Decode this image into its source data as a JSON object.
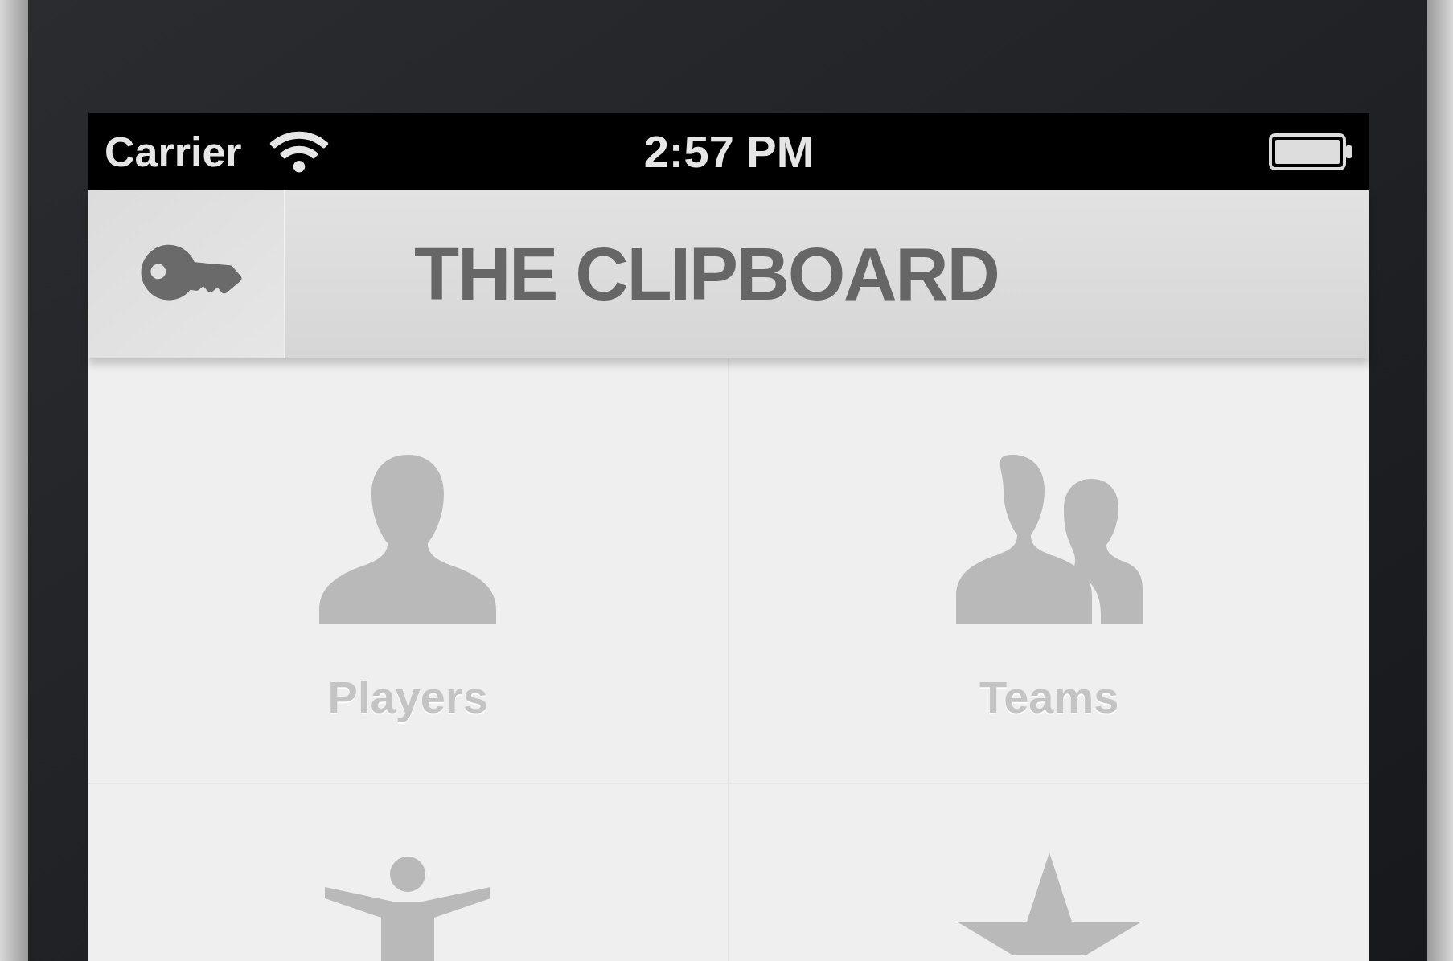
{
  "status_bar": {
    "carrier": "Carrier",
    "time": "2:57 PM"
  },
  "nav_bar": {
    "title": "THE CLIPBOARD"
  },
  "tiles": [
    {
      "label": "Players"
    },
    {
      "label": "Teams"
    }
  ]
}
